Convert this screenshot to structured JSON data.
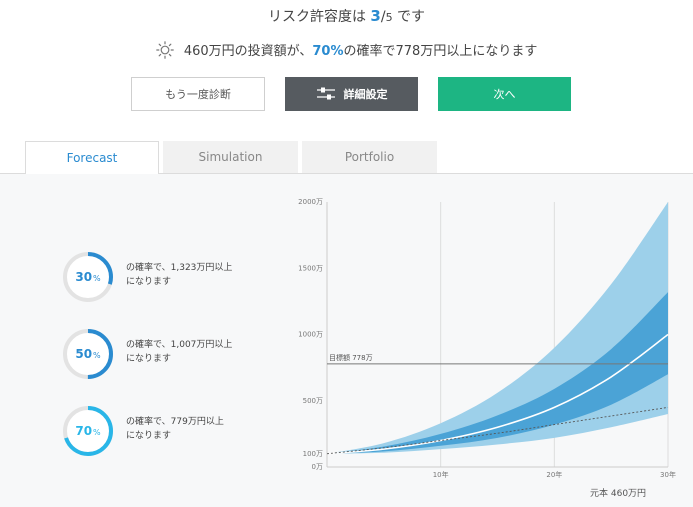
{
  "header": {
    "risk_prefix": "リスク許容度は",
    "risk_value": "3",
    "risk_slash": "/",
    "risk_max": "5",
    "risk_suffix": "です",
    "summary_prefix": "460万円の投資額が、",
    "summary_pct": "70%",
    "summary_suffix": "の確率で778万円以上になります",
    "summary_icon": "sun-icon"
  },
  "buttons": {
    "retry": "もう一度診断",
    "detail": "詳細設定",
    "detail_icon": "sliders-icon",
    "next": "次へ",
    "colors": {
      "detail": "#565b60",
      "next": "#1db583"
    }
  },
  "tabs": [
    {
      "label": "Forecast",
      "active": true
    },
    {
      "label": "Simulation",
      "active": false
    },
    {
      "label": "Portfolio",
      "active": false
    }
  ],
  "probabilities": [
    {
      "pct": "30",
      "unit": "%",
      "fraction": 0.3,
      "line1": "の確率で、1,323万円以上",
      "line2": "になります",
      "color": "#2a8bd0"
    },
    {
      "pct": "50",
      "unit": "%",
      "fraction": 0.5,
      "line1": "の確率で、1,007万円以上",
      "line2": "になります",
      "color": "#2a8bd0"
    },
    {
      "pct": "70",
      "unit": "%",
      "fraction": 0.7,
      "line1": "の確率で、779万円以上",
      "line2": "になります",
      "color": "#29b6e8"
    }
  ],
  "principal_label": "元本 460万円",
  "chart_data": {
    "type": "area",
    "x": [
      0,
      5,
      10,
      15,
      20,
      25,
      30
    ],
    "y_ticks": [
      {
        "v": 0,
        "label": "0万"
      },
      {
        "v": 100,
        "label": "100万"
      },
      {
        "v": 500,
        "label": "500万"
      },
      {
        "v": 1000,
        "label": "1000万"
      },
      {
        "v": 1500,
        "label": "1500万"
      },
      {
        "v": 2000,
        "label": "2000万"
      }
    ],
    "x_ticks": [
      {
        "v": 10,
        "label": "10年"
      },
      {
        "v": 20,
        "label": "20年"
      },
      {
        "v": 30,
        "label": "30年"
      }
    ],
    "xlim": [
      0,
      30
    ],
    "ylim": [
      0,
      2000
    ],
    "outer_upper": [
      100,
      180,
      330,
      560,
      900,
      1380,
      2000
    ],
    "inner_upper": [
      100,
      155,
      250,
      390,
      590,
      890,
      1320
    ],
    "median": [
      100,
      135,
      200,
      300,
      450,
      680,
      1000
    ],
    "inner_lower": [
      100,
      118,
      160,
      220,
      320,
      470,
      700
    ],
    "outer_lower": [
      100,
      108,
      135,
      170,
      220,
      300,
      400
    ],
    "principal_line": [
      100,
      145,
      200,
      255,
      320,
      385,
      450
    ],
    "target": {
      "value": 778,
      "label": "目標額 778万"
    },
    "colors": {
      "outer": "#9dd0ea",
      "inner": "#4ba3d6",
      "median": "#ffffff",
      "target": "#777777",
      "principal": "#555555"
    }
  }
}
